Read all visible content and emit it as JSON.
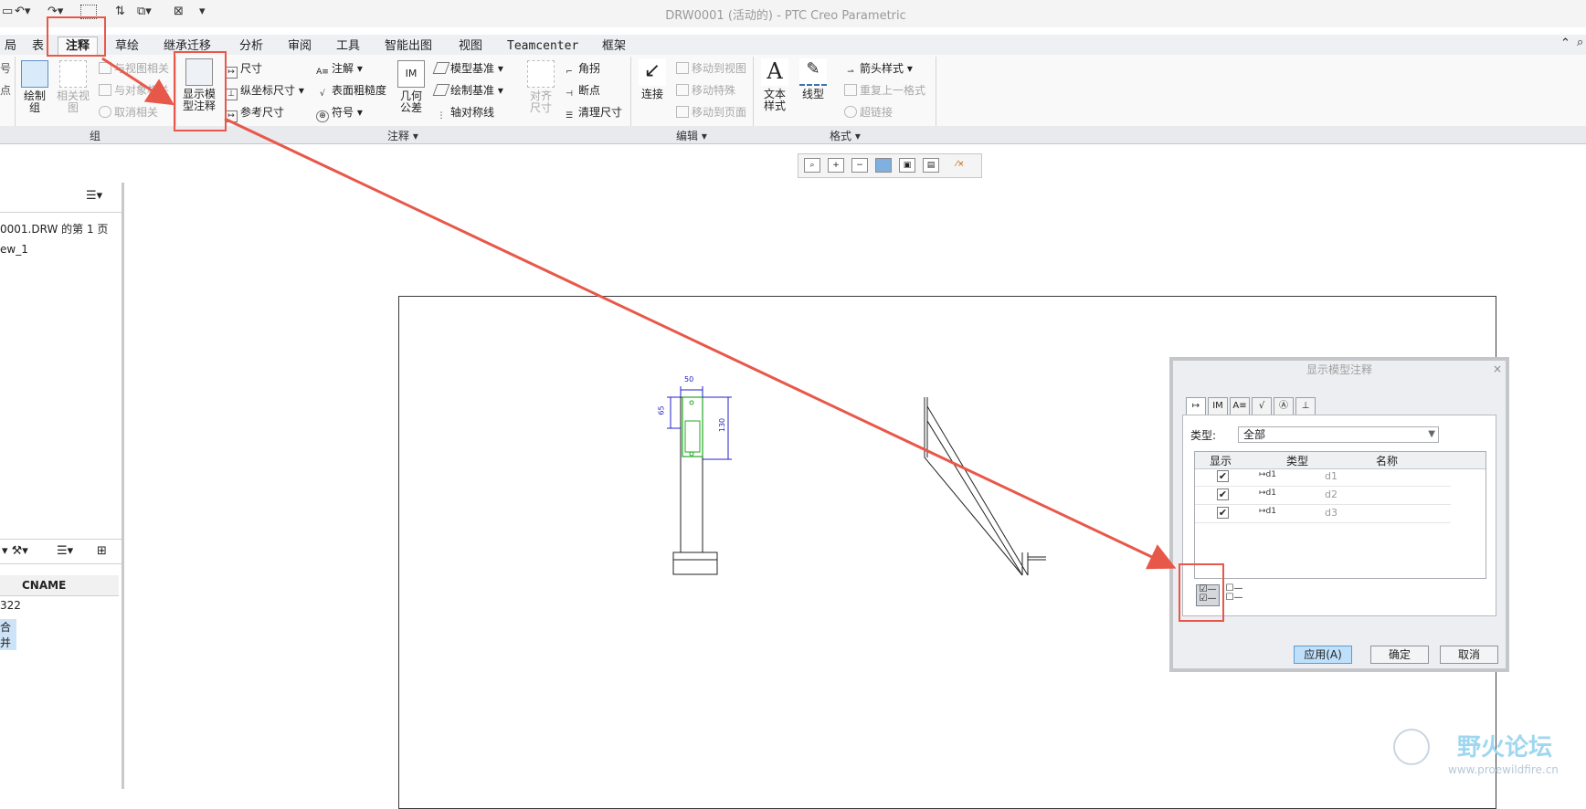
{
  "window": {
    "title": "DRW0001 (活动的) - PTC Creo Parametric"
  },
  "tabs": [
    {
      "label": "局"
    },
    {
      "label": "表"
    },
    {
      "label": "注释",
      "active": true
    },
    {
      "label": "草绘"
    },
    {
      "label": "继承迁移"
    },
    {
      "label": "分析"
    },
    {
      "label": "审阅"
    },
    {
      "label": "工具"
    },
    {
      "label": "智能出图"
    },
    {
      "label": "视图"
    },
    {
      "label": "Teamcenter"
    },
    {
      "label": "框架"
    }
  ],
  "ribbon": {
    "group1": {
      "draw_group": "绘制\n组",
      "related_view": "相关视\n图",
      "relate_to_view": "与视图相关",
      "relate_to_object": "与对象相关",
      "unrelate": "取消相关",
      "label": "组"
    },
    "annotate": {
      "show_model_annotations": "显示模\n型注释",
      "dimension": "尺寸",
      "ordinate_dimension": "纵坐标尺寸",
      "reference_dimension": "参考尺寸",
      "note": "注解",
      "surface_finish": "表面粗糙度",
      "symbol": "符号",
      "geometric_tolerance": "几何\n公差",
      "model_datum": "模型基准",
      "draft_datum": "绘制基准",
      "axis_of_symmetry": "轴对称线",
      "align_dimension": "对齐\n尺寸",
      "angle_gap": "角拐",
      "break": "断点",
      "cleanup_dims": "清理尺寸",
      "label": "注释"
    },
    "edit": {
      "connect": "连接",
      "move_to_view": "移动到视图",
      "move_special": "移动特殊",
      "move_to_sheet": "移动到页面",
      "label": "编辑"
    },
    "format": {
      "text_style": "文本\n样式",
      "line_style": "线型",
      "arrow_style": "箭头样式",
      "repeat_last_format": "重复上一格式",
      "hyperlink": "超链接",
      "label": "格式"
    }
  },
  "left_panel": {
    "tree_items": [
      "0001.DRW 的第 1 页",
      "ew_1"
    ],
    "column_header": "CNAME",
    "rows": [
      "322",
      "合并"
    ]
  },
  "dimensions": {
    "d_top": "50",
    "d_left": "65",
    "d_right": "130"
  },
  "dialog": {
    "title": "显示模型注释",
    "close": "×",
    "type_label": "类型:",
    "type_value": "全部",
    "columns": [
      "显示",
      "类型",
      "名称"
    ],
    "rows": [
      {
        "show": true,
        "type": "d1",
        "name": "d1"
      },
      {
        "show": true,
        "type": "d1",
        "name": "d2"
      },
      {
        "show": true,
        "type": "d1",
        "name": "d3"
      }
    ],
    "buttons": {
      "apply": "应用(A)",
      "ok": "确定",
      "cancel": "取消"
    }
  },
  "watermark": {
    "title": "野火论坛",
    "url": "www.proewildfire.cn"
  },
  "colors": {
    "annotation_red": "#e8584a",
    "dim_blue": "#2222cc",
    "highlight_green": "#22aa22"
  }
}
